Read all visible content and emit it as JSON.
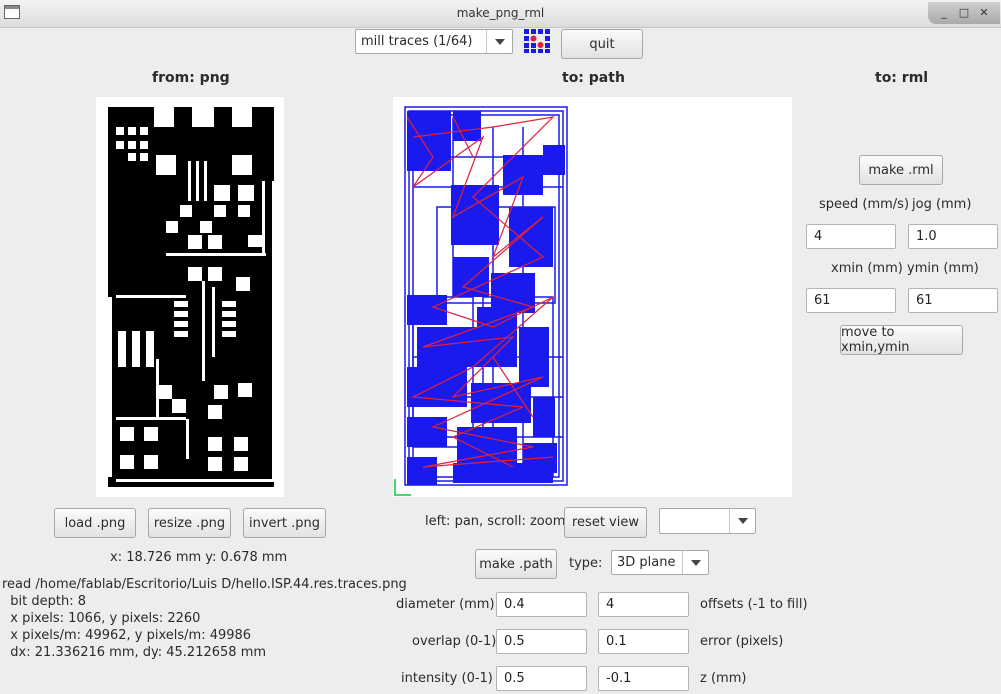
{
  "window": {
    "title": "make_png_rml",
    "controls": [
      "_",
      "□",
      "✕"
    ]
  },
  "toolbar": {
    "mode_select": "mill traces (1/64)",
    "quit_label": "quit"
  },
  "columns": {
    "from": "from: png",
    "to_path": "to: path",
    "to_rml": "to: rml"
  },
  "png_panel": {
    "buttons": {
      "load": "load .png",
      "resize": "resize .png",
      "invert": "invert .png"
    },
    "coords": "x: 18.726 mm  y: 0.678 mm",
    "info": [
      "read /home/fablab/Escritorio/Luis D/hello.ISP.44.res.traces.png",
      "  bit depth: 8",
      "  x pixels: 1066, y pixels: 2260",
      "  x pixels/m: 49962, y pixels/m: 49986",
      "  dx: 21.336216 mm, dy: 45.212658 mm"
    ]
  },
  "path_panel": {
    "hint": "left: pan, scroll: zoom",
    "reset_view": "reset view",
    "view_select": "",
    "make_path": "make .path",
    "type_label": "type:",
    "type_value": "3D plane",
    "params": [
      {
        "label": "diameter (mm)",
        "value": "0.4",
        "value2": "4",
        "label2": "offsets (-1 to fill)"
      },
      {
        "label": "overlap (0-1)",
        "value": "0.5",
        "value2": "0.1",
        "label2": "error (pixels)"
      },
      {
        "label": "intensity (0-1)",
        "value": "0.5",
        "value2": "-0.1",
        "label2": "z (mm)"
      }
    ]
  },
  "rml_panel": {
    "make_rml": "make .rml",
    "speed_label": "speed (mm/s)",
    "jog_label": "jog (mm)",
    "speed": "4",
    "jog": "1.0",
    "xmin_label": "xmin (mm)",
    "ymin_label": "ymin (mm)",
    "xmin": "61",
    "ymin": "61",
    "move_label": "move to xmin,ymin"
  },
  "colors": {
    "path_blue": "#1a1aee",
    "path_red": "#e0203a",
    "pcb_black": "#000000"
  }
}
